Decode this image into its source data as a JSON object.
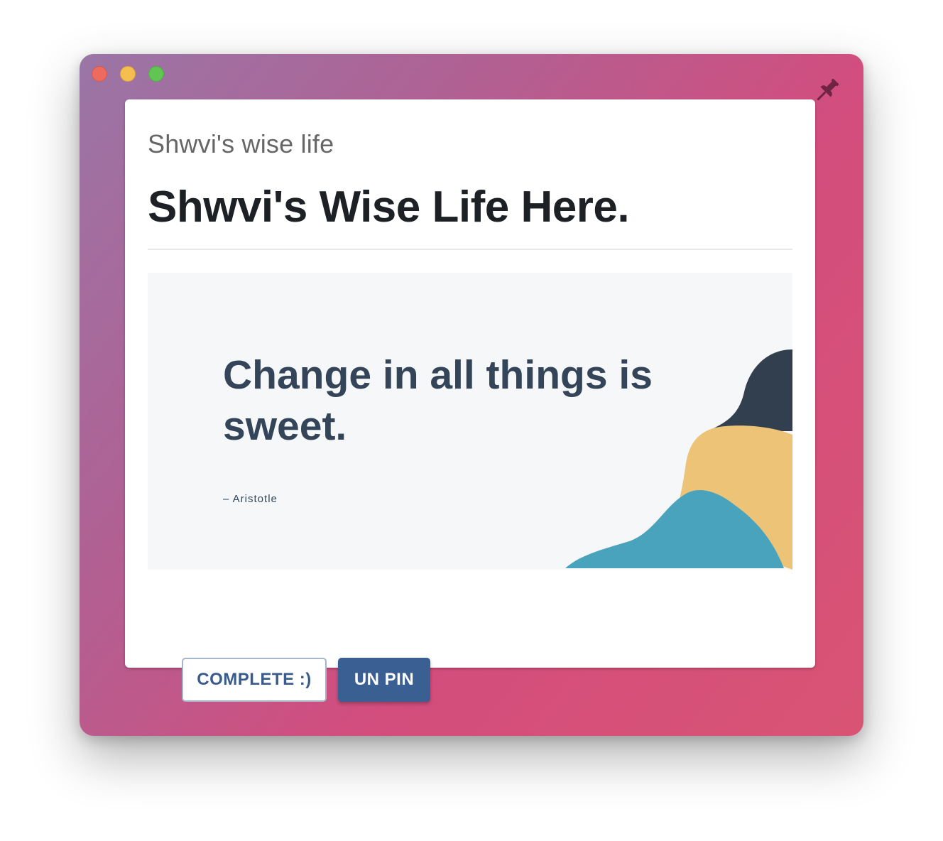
{
  "card": {
    "subtitle": "Shwvi's wise life",
    "title": "Shwvi's Wise Life Here."
  },
  "image": {
    "quote": "Change in all things is sweet.",
    "author": "– Aristotle"
  },
  "buttons": {
    "complete_label": "COMPLETE :)",
    "unpin_label": "UN PIN"
  },
  "icons": {
    "pin": "pin-icon"
  },
  "colors": {
    "primary": "#3a5f93",
    "outline": "#a6b6c9",
    "quote_text": "#344559",
    "blob_dark": "#323f4f",
    "blob_yellow": "#edc477",
    "blob_teal": "#4aa3bc",
    "window_gradient_start": "#9a76a6",
    "window_gradient_end": "#d34d7d"
  }
}
